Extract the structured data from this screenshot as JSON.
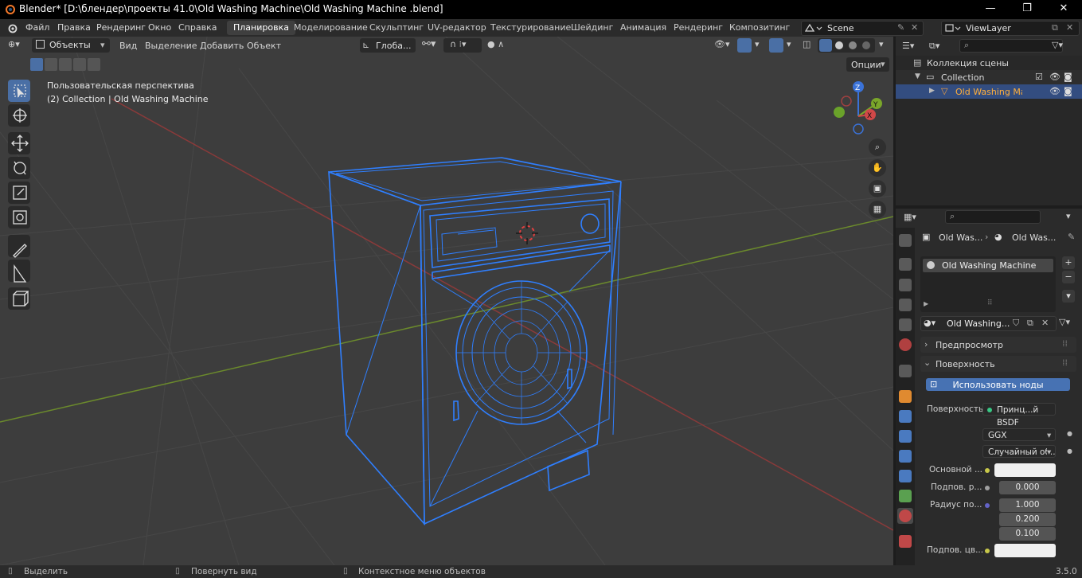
{
  "window": {
    "title": "Blender* [D:\\блендер\\проекты 41.0\\Old Washing Machine\\Old Washing Machine .blend]",
    "minimize": "—",
    "maximize": "❐",
    "close": "✕"
  },
  "menu": {
    "items": [
      "Файл",
      "Правка",
      "Рендеринг",
      "Окно",
      "Справка"
    ]
  },
  "workspaces": {
    "tabs": [
      "Планировка",
      "Моделирование",
      "Скульптинг",
      "UV-редактор",
      "Текстурирование",
      "Шейдинг",
      "Анимация",
      "Рендеринг",
      "Композитинг"
    ],
    "active": "Планировка"
  },
  "scene": {
    "name": "Scene",
    "viewlayer": "ViewLayer"
  },
  "viewport": {
    "mode": "Объекты",
    "menus": [
      "Вид",
      "Выделение",
      "Добавить",
      "Объект"
    ],
    "orientation": "Глоба...",
    "options": "Опции",
    "view_name": "Пользовательская перспектива",
    "collection_info": "(2) Collection | Old Washing Machine",
    "wire_color": "#2f7fff",
    "background": "#3d3d3d",
    "gizmo": {
      "z": "Z",
      "y": "Y",
      "x": "X"
    }
  },
  "outliner": {
    "root": "Коллекция сцены",
    "collection": "Collection",
    "object": "Old Washing Machine"
  },
  "properties": {
    "breadcrumb_obj": "Old Was...",
    "breadcrumb_mat": "Old Was...",
    "slot": "Old Washing Machine",
    "material_name": "Old Washing...",
    "panels": {
      "preview": "Предпросмотр",
      "surface": "Поверхность"
    },
    "use_nodes": "Использовать ноды",
    "surface_label": "Поверхность",
    "surface_value": "Принц...й BSDF",
    "distribution": "GGX",
    "subsurface_method": "Случайный об...",
    "rows": [
      {
        "label": "Основной ...",
        "value": ""
      },
      {
        "label": "Подпов. р...",
        "value": "0.000"
      },
      {
        "label": "Радиус по...",
        "value": "1.000"
      },
      {
        "label": "",
        "value": "0.200"
      },
      {
        "label": "",
        "value": "0.100"
      },
      {
        "label": "Подпов. цв...",
        "value": ""
      }
    ]
  },
  "statusbar": {
    "select": "Выделить",
    "rotate": "Повернуть вид",
    "context": "Контекстное меню объектов",
    "version": "3.5.0"
  }
}
